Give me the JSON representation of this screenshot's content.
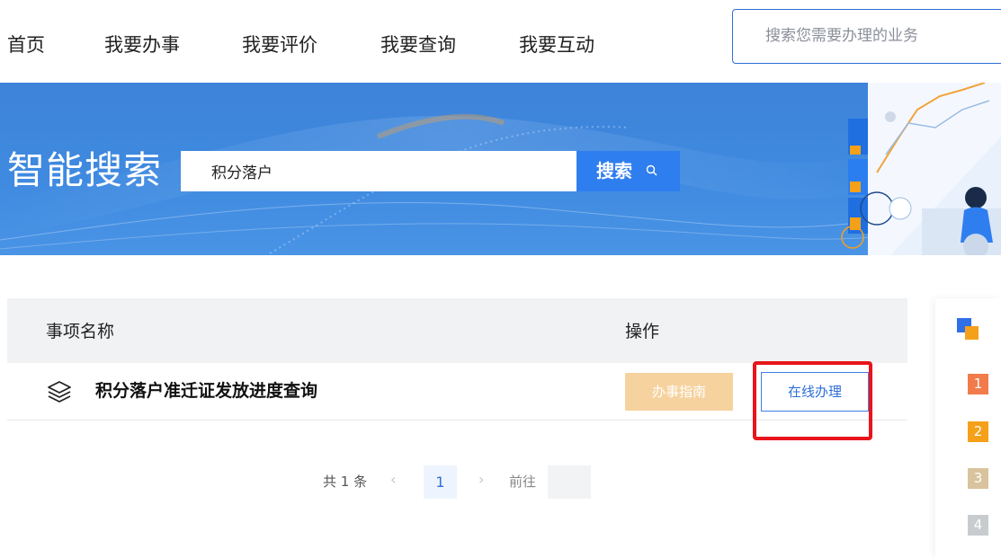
{
  "nav": {
    "items": [
      "首页",
      "我要办事",
      "我要评价",
      "我要查询",
      "我要互动"
    ],
    "search_placeholder": "搜索您需要办理的业务"
  },
  "banner": {
    "title": "智能搜索",
    "search_value": "积分落户",
    "search_button": "搜索"
  },
  "table": {
    "headers": {
      "name": "事项名称",
      "action": "操作"
    },
    "rows": [
      {
        "name": "积分落户准迁证发放进度查询",
        "guide_label": "办事指南",
        "online_label": "在线办理"
      }
    ]
  },
  "pagination": {
    "total": "共 1 条",
    "prev": "‹",
    "current": "1",
    "next": "›",
    "goto_label": "前往",
    "goto_value": ""
  },
  "ranking": [
    "1",
    "2",
    "3",
    "4"
  ],
  "colors": {
    "accent": "#2f7ef0",
    "guide": "#f6d29e",
    "highlight": "#e8151b",
    "rank1": "#f27b4b",
    "rank2": "#f5a019",
    "rank3": "#d9c39c",
    "rank4": "#c9cccf"
  }
}
